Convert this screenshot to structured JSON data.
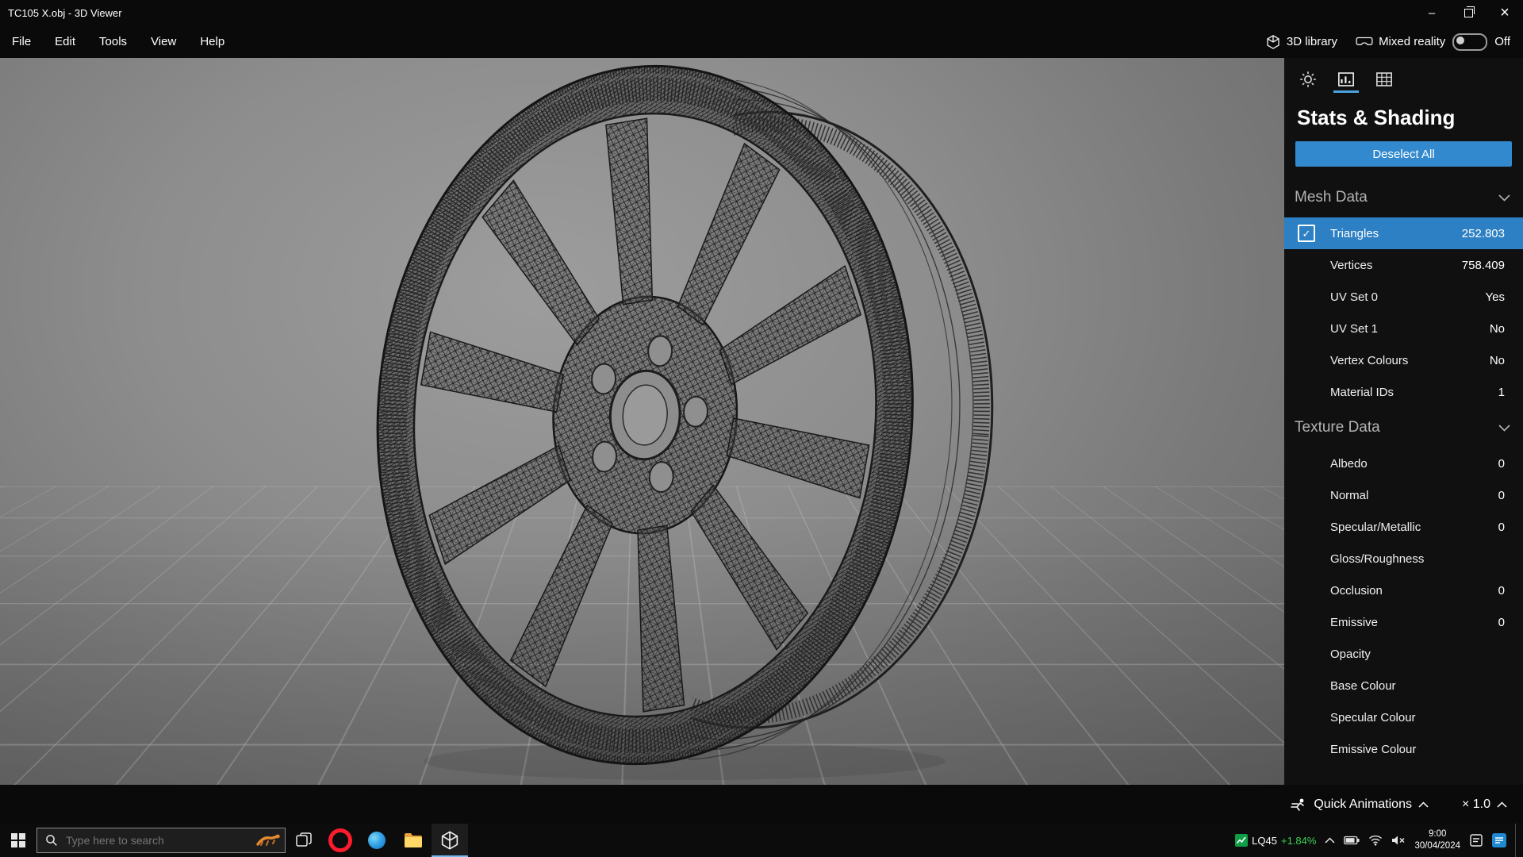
{
  "titlebar": {
    "title": "TC105 X.obj - 3D Viewer"
  },
  "menubar": {
    "items": [
      "File",
      "Edit",
      "Tools",
      "View",
      "Help"
    ],
    "library_label": "3D library",
    "mixed_reality_label": "Mixed reality",
    "mixed_reality_state": "Off"
  },
  "panel": {
    "title": "Stats & Shading",
    "deselect_button": "Deselect All",
    "mesh": {
      "title": "Mesh Data",
      "rows": [
        {
          "label": "Triangles",
          "value": "252.803",
          "selected": true
        },
        {
          "label": "Vertices",
          "value": "758.409"
        },
        {
          "label": "UV Set 0",
          "value": "Yes"
        },
        {
          "label": "UV Set 1",
          "value": "No"
        },
        {
          "label": "Vertex Colours",
          "value": "No"
        },
        {
          "label": "Material IDs",
          "value": "1"
        }
      ]
    },
    "texture": {
      "title": "Texture Data",
      "rows": [
        {
          "label": "Albedo",
          "value": "0"
        },
        {
          "label": "Normal",
          "value": "0"
        },
        {
          "label": "Specular/Metallic",
          "value": "0"
        },
        {
          "label": "Gloss/Roughness",
          "value": ""
        },
        {
          "label": "Occlusion",
          "value": "0"
        },
        {
          "label": "Emissive",
          "value": "0"
        },
        {
          "label": "Opacity",
          "value": ""
        },
        {
          "label": "Base Colour",
          "value": ""
        },
        {
          "label": "Specular Colour",
          "value": ""
        },
        {
          "label": "Emissive Colour",
          "value": ""
        }
      ]
    }
  },
  "bottombar": {
    "quick_animations": "Quick Animations",
    "speed": "× 1.0"
  },
  "taskbar": {
    "search_placeholder": "Type here to search",
    "ticker_symbol": "LQ45",
    "ticker_change": "+1.84%",
    "time": "9:00",
    "date": "30/04/2024"
  },
  "icons": {
    "minimize": "–",
    "close": "×",
    "check": "✓"
  },
  "colors": {
    "accent_blue": "#3289cd",
    "row_selection": "#2e80c4",
    "ticker_green": "#3fd158",
    "tab_underline": "#4ca2e0"
  }
}
